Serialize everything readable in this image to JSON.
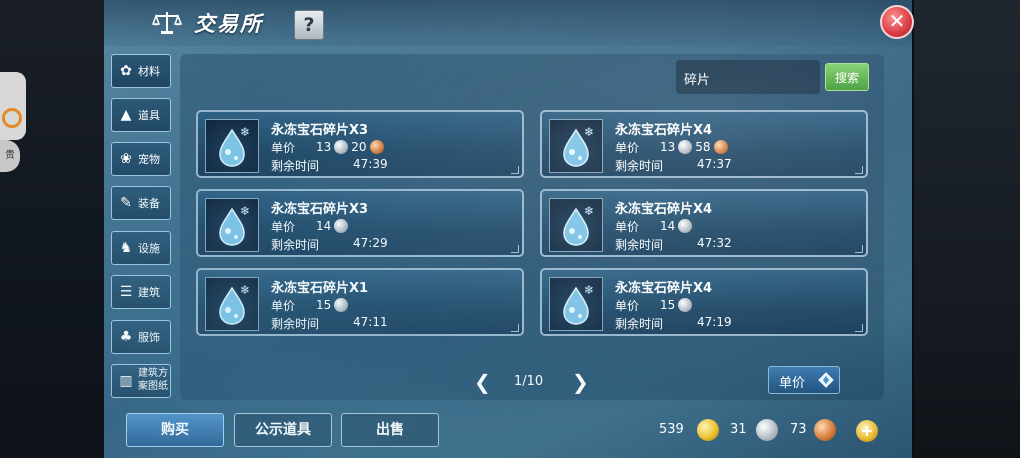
{
  "header": {
    "title": "交易所",
    "help_label": "?",
    "close_label": "✕"
  },
  "sidebar": {
    "items": [
      {
        "label": "材料",
        "icon": "materials-icon"
      },
      {
        "label": "道具",
        "icon": "props-icon"
      },
      {
        "label": "宠物",
        "icon": "paw-icon"
      },
      {
        "label": "装备",
        "icon": "equipment-icon"
      },
      {
        "label": "设施",
        "icon": "facility-icon"
      },
      {
        "label": "建筑",
        "icon": "building-icon"
      },
      {
        "label": "服饰",
        "icon": "clothing-icon"
      },
      {
        "label": "建筑方案图纸",
        "icon": "blueprint-icon"
      }
    ]
  },
  "search": {
    "value": "碎片",
    "button_label": "搜索"
  },
  "listings": [
    {
      "name": "永冻宝石碎片X3",
      "price_label": "单价",
      "silver": "13",
      "copper": "20",
      "time_label": "剩余时间",
      "time": "47:39"
    },
    {
      "name": "永冻宝石碎片X4",
      "price_label": "单价",
      "silver": "13",
      "copper": "58",
      "time_label": "剩余时间",
      "time": "47:37"
    },
    {
      "name": "永冻宝石碎片X3",
      "price_label": "单价",
      "silver": "14",
      "copper": "",
      "time_label": "剩余时间",
      "time": "47:29"
    },
    {
      "name": "永冻宝石碎片X4",
      "price_label": "单价",
      "silver": "14",
      "copper": "",
      "time_label": "剩余时间",
      "time": "47:32"
    },
    {
      "name": "永冻宝石碎片X1",
      "price_label": "单价",
      "silver": "15",
      "copper": "",
      "time_label": "剩余时间",
      "time": "47:11"
    },
    {
      "name": "永冻宝石碎片X4",
      "price_label": "单价",
      "silver": "15",
      "copper": "",
      "time_label": "剩余时间",
      "time": "47:19"
    }
  ],
  "pagination": {
    "current": "1/10",
    "prev": "❮",
    "next": "❯"
  },
  "sort": {
    "label": "单价"
  },
  "bottom": {
    "buy_label": "购买",
    "public_items_label": "公示道具",
    "sell_label": "出售"
  },
  "currency": {
    "gold": "539",
    "silver": "31",
    "copper": "73",
    "add_label": "+"
  },
  "edge_badge": "贵"
}
